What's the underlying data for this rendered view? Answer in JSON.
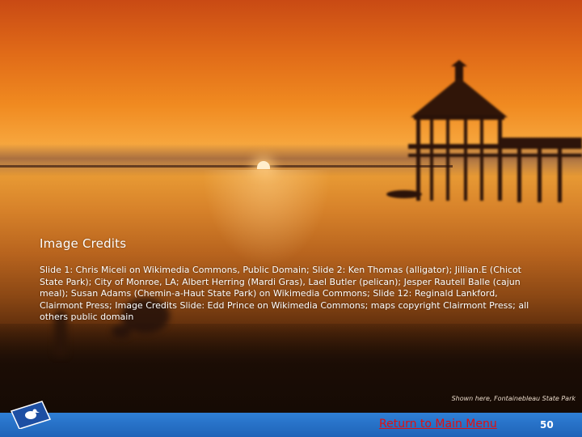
{
  "slide": {
    "title": "Image Credits",
    "body": "Slide 1: Chris Miceli on Wikimedia Commons, Public Domain; Slide 2: Ken Thomas (alligator); Jillian.E (Chicot State Park); City of Monroe, LA; Albert Herring (Mardi Gras), Lael Butler (pelican); Jesper Rautell Balle (cajun meal); Susan Adams (Chemin-a-Haut State Park) on Wikimedia Commons; Slide 12: Reginald Lankford, Clairmont Press; Image Credits Slide: Edd Prince on Wikimedia Commons; maps copyright Clairmont Press; all others public domain",
    "caption": "Shown here, Fontainebleau State Park",
    "background_image": "sunset-pier-gazebo-photo"
  },
  "footer": {
    "return_link_label": "Return to Main Menu",
    "page_number": "50",
    "bar_color": "#2a74cc",
    "link_color": "#e01010",
    "logo_icon": "louisiana-pelican-flag-icon"
  }
}
